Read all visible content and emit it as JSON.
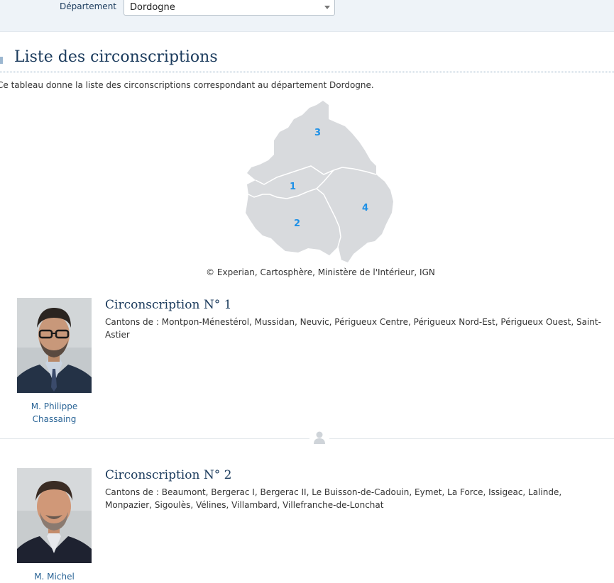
{
  "filter": {
    "label": "Département",
    "selected": "Dordogne"
  },
  "section": {
    "title": "Liste des circonscriptions",
    "intro": "Ce tableau donne la liste des circonscriptions correspondant au département Dordogne."
  },
  "map": {
    "labels": [
      "3",
      "1",
      "2",
      "4"
    ],
    "credit": "© Experian, Cartosphère, Ministère de l'Intérieur, IGN",
    "colors": {
      "region": "#d8dadd",
      "border": "#ffffff",
      "label": "#1e90e6"
    }
  },
  "circonscriptions": [
    {
      "title": "Circonscription N° 1",
      "cantons": "Cantons de : Montpon-Ménestérol, Mussidan, Neuvic, Périgueux Centre, Périgueux Nord-Est, Périgueux Ouest, Saint-Astier",
      "deputy": {
        "name_line1": "M. Philippe",
        "name_line2": "Chassaing"
      }
    },
    {
      "title": "Circonscription N° 2",
      "cantons": "Cantons de : Beaumont, Bergerac I, Bergerac II, Le Buisson-de-Cadouin, Eymet, La Force, Issigeac, Lalinde, Monpazier, Sigoulès, Vélines, Villambard, Villefranche-de-Lonchat",
      "deputy": {
        "name_line1": "M. Michel",
        "name_line2": ""
      }
    }
  ],
  "icons": {
    "divider": "user-icon",
    "select": "chevron-down-icon"
  }
}
